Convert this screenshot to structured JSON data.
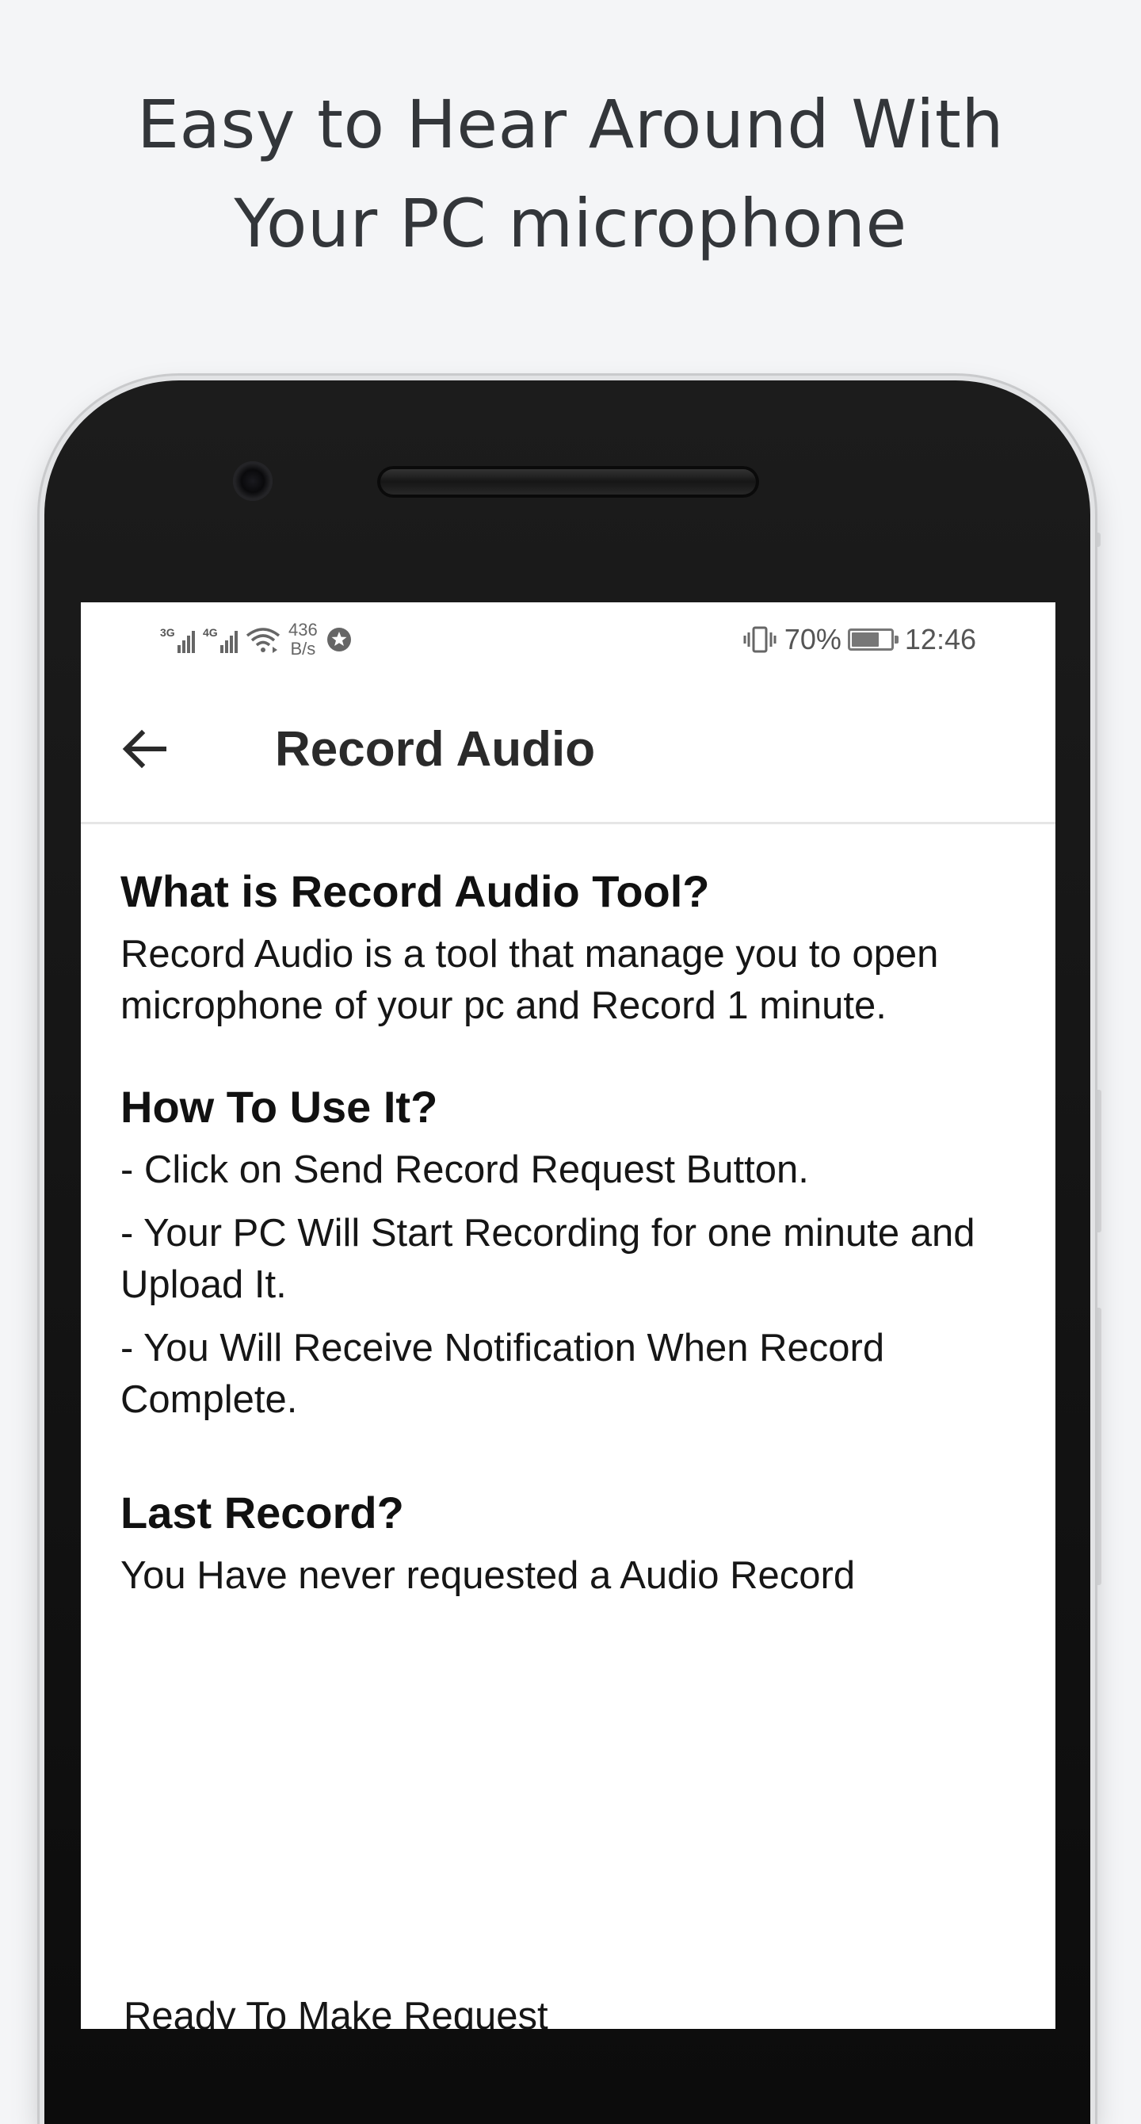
{
  "promo": {
    "headline_line1": "Easy to Hear Around With",
    "headline_line2": "Your PC microphone"
  },
  "status_bar": {
    "network_1": "3G",
    "network_2": "4G",
    "speed_value": "436",
    "speed_unit": "B/s",
    "battery_percent": "70%",
    "battery_level": 0.7,
    "time": "12:46",
    "icons": [
      "signal-icon",
      "signal-icon",
      "wifi-icon",
      "badge-icon",
      "vibrate-icon",
      "battery-icon"
    ]
  },
  "app_bar": {
    "back_icon": "arrow-left-icon",
    "title": "Record Audio"
  },
  "content": {
    "what_title": "What is Record Audio Tool?",
    "what_body": "Record Audio is a tool that manage you to open microphone of your pc and Record 1 minute.",
    "how_title": "How To Use It?",
    "steps": [
      "- Click on Send Record Request Button.",
      "- Your PC Will Start Recording for one minute and Upload It.",
      "- You Will Receive Notification When Record Complete."
    ],
    "last_title": "Last Record?",
    "last_body": "You Have never requested a Audio Record",
    "ready_status": "Ready To Make Request"
  },
  "colors": {
    "page_background": "#f4f5f7",
    "headline_text": "#33363a",
    "phone_body": "#111111",
    "screen_background": "#ffffff"
  }
}
